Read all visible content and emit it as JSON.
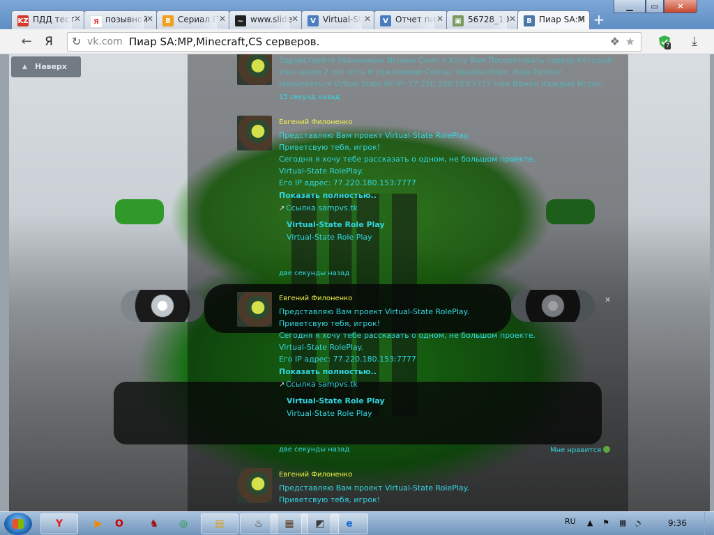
{
  "browser": {
    "tabs": [
      {
        "label": "ПДД тест",
        "favicon": "KZ",
        "color": "#d33b2c"
      },
      {
        "label": "позывной",
        "favicon": "Я",
        "color": "#e33"
      },
      {
        "label": "Сериал Г",
        "favicon": "B",
        "color": "#f0a020"
      },
      {
        "label": "www.slide",
        "favicon": "~",
        "color": "#222"
      },
      {
        "label": "Virtual-St",
        "favicon": "V",
        "color": "#4a7cc0"
      },
      {
        "label": "Отчет пи",
        "favicon": "V",
        "color": "#4a7cc0"
      },
      {
        "label": "56728_10",
        "favicon": "▣",
        "color": "#7a9a60"
      },
      {
        "label": "Пиар SA:М",
        "favicon": "B",
        "color": "#4a76a8"
      }
    ],
    "window_buttons": {
      "minimize": "▁",
      "maximize": "▭",
      "close": "✕"
    },
    "address": {
      "domain": "vk.com",
      "page_title": "Пиар SA:MP,Minecraft,CS серверов."
    },
    "icons": {
      "back": "back-arrow-icon",
      "yandex": "Я",
      "extensions": "puzzle-icon",
      "bookmark": "star-icon",
      "adblock_badge": "7",
      "download": "download-icon"
    }
  },
  "page": {
    "top_button": "Наверх",
    "first_post": {
      "text": "Здравствуйте Уважаемые Игроки Самп я Хочу Вам Посоветовать сервер Который Уже около 2 лет есть К сожелению Сейчас Онлайн Упал. Наш Проект Называеться Virtual State RP IP: 77.220.180.153:7777 Нам Важен Каждый Игрок.",
      "time": "15 секунд назад"
    },
    "posts": [
      {
        "author": "Евгений Филоненко",
        "lines": [
          "Представляю Вам проект Virtual-State RolePlay.",
          "Приветсвую тебя, игрок!",
          "Сегодня я хочу тебе рассказать о одном, не большом проекте.",
          "Virtual-State RolePlay.",
          "Его IP адрес: 77.220.180.153:7777"
        ],
        "more": "Показать полностью..",
        "link": "Ссылка sampvs.tk",
        "link_title": "Virtual-State Role Play",
        "link_desc": "Virtual-State Role Play",
        "time": "две секунды назад"
      },
      {
        "author": "Евгений Филоненко",
        "lines": [
          "Представляю Вам проект Virtual-State RolePlay.",
          "Приветсвую тебя, игрок!",
          "Сегодня я хочу тебе рассказать о одном, не большом проекте.",
          "Virtual-State RolePlay.",
          "Его IP адрес: 77.220.180.153:7777"
        ],
        "more": "Показать полностью..",
        "link": "Ссылка sampvs.tk",
        "link_title": "Virtual-State Role Play",
        "link_desc": "Virtual-State Role Play",
        "time": "две секунды назад",
        "like": "Мне нравится"
      },
      {
        "author": "Евгений Филоненко",
        "lines": [
          "Представляю Вам проект Virtual-State RolePlay.",
          "Приветсвую тебя, игрок!"
        ]
      }
    ]
  },
  "taskbar": {
    "apps": [
      "Y",
      "▶",
      "O",
      "♞",
      "◎",
      "▤",
      "♨",
      "▦",
      "◩",
      "e"
    ],
    "lang": "RU",
    "time": "9:36"
  }
}
